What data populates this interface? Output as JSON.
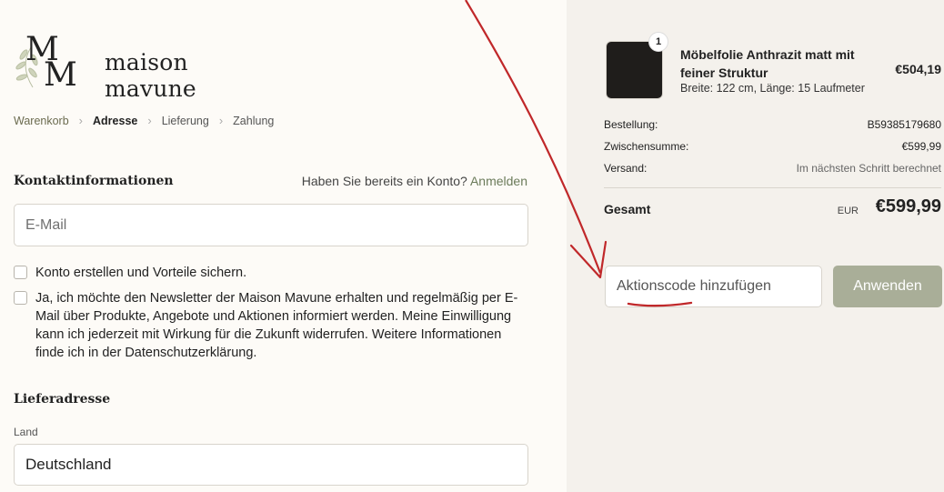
{
  "brand": {
    "name": "maison mavune",
    "mark": "MM"
  },
  "breadcrumb": {
    "items": [
      {
        "label": "Warenkorb"
      },
      {
        "label": "Adresse"
      },
      {
        "label": "Lieferung"
      },
      {
        "label": "Zahlung"
      }
    ],
    "active_index": 1
  },
  "contact": {
    "title": "Kontaktinformationen",
    "login_prompt": "Haben Sie bereits ein Konto?",
    "login_link": "Anmelden",
    "email_placeholder": "E-Mail",
    "create_account_label": "Konto erstellen und Vorteile sichern.",
    "newsletter_label": "Ja, ich möchte den Newsletter der Maison Mavune erhalten und regelmäßig per E-Mail über Produkte, Angebote und Aktionen informiert werden. Meine Einwilligung kann ich jederzeit mit Wirkung für die Zukunft widerrufen. Weitere Informationen finde ich in der Datenschutzerklärung."
  },
  "shipping": {
    "title": "Lieferadresse",
    "country_label": "Land",
    "country_value": "Deutschland"
  },
  "summary": {
    "product": {
      "quantity": "1",
      "name": "Möbelfolie Anthrazit matt mit feiner Struktur",
      "variant": "Breite: 122 cm, Länge: 15 Laufmeter",
      "price": "€504,19"
    },
    "order_label": "Bestellung:",
    "order_value": "B59385179680",
    "subtotal_label": "Zwischensumme:",
    "subtotal_value": "€599,99",
    "shipping_label": "Versand:",
    "shipping_value": "Im nächsten Schritt berechnet",
    "total_label": "Gesamt",
    "total_currency": "EUR",
    "total_value": "€599,99",
    "promo_placeholder": "Aktionscode hinzufügen",
    "apply_label": "Anwenden"
  },
  "colors": {
    "accent_green": "#6b7b5a",
    "apply_button": "#a9ae98",
    "annotation_red": "#c0282a",
    "sidebar_bg": "#f4f1ec"
  }
}
